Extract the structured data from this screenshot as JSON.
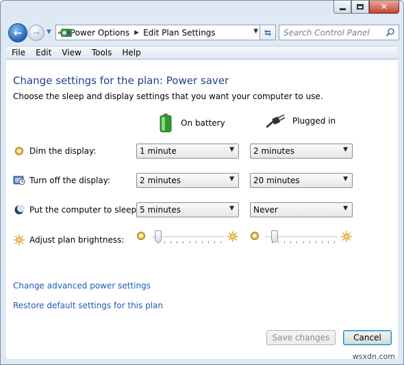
{
  "window": {
    "caption_close": "✕"
  },
  "address_bar": {
    "segments": [
      "Power Options",
      "Edit Plan Settings"
    ],
    "overflow": "«"
  },
  "search": {
    "placeholder": "Search Control Panel"
  },
  "menu": [
    "File",
    "Edit",
    "View",
    "Tools",
    "Help"
  ],
  "content": {
    "heading": "Change settings for the plan: Power saver",
    "subheading": "Choose the sleep and display settings that you want your computer to use.",
    "columns": {
      "battery": "On battery",
      "plugged": "Plugged in"
    },
    "rows": [
      {
        "label": "Dim the display:",
        "icon": "dim-icon",
        "battery": "1 minute",
        "plugged": "2 minutes"
      },
      {
        "label": "Turn off the display:",
        "icon": "monitor-clock-icon",
        "battery": "2 minutes",
        "plugged": "20 minutes"
      },
      {
        "label": "Put the computer to sleep:",
        "icon": "moon-icon",
        "battery": "5 minutes",
        "plugged": "Never"
      }
    ],
    "brightness": {
      "label": "Adjust plan brightness:",
      "battery_level": 0.0,
      "plugged_level": 0.05
    },
    "links": {
      "advanced": "Change advanced power settings",
      "restore": "Restore default settings for this plan"
    },
    "buttons": {
      "save": "Save changes",
      "cancel": "Cancel"
    }
  },
  "watermark": "wsxdn.com",
  "colors": {
    "heading": "#1e3f8a",
    "link": "#1e5ab4",
    "window_frame": "#dfe9f5"
  }
}
